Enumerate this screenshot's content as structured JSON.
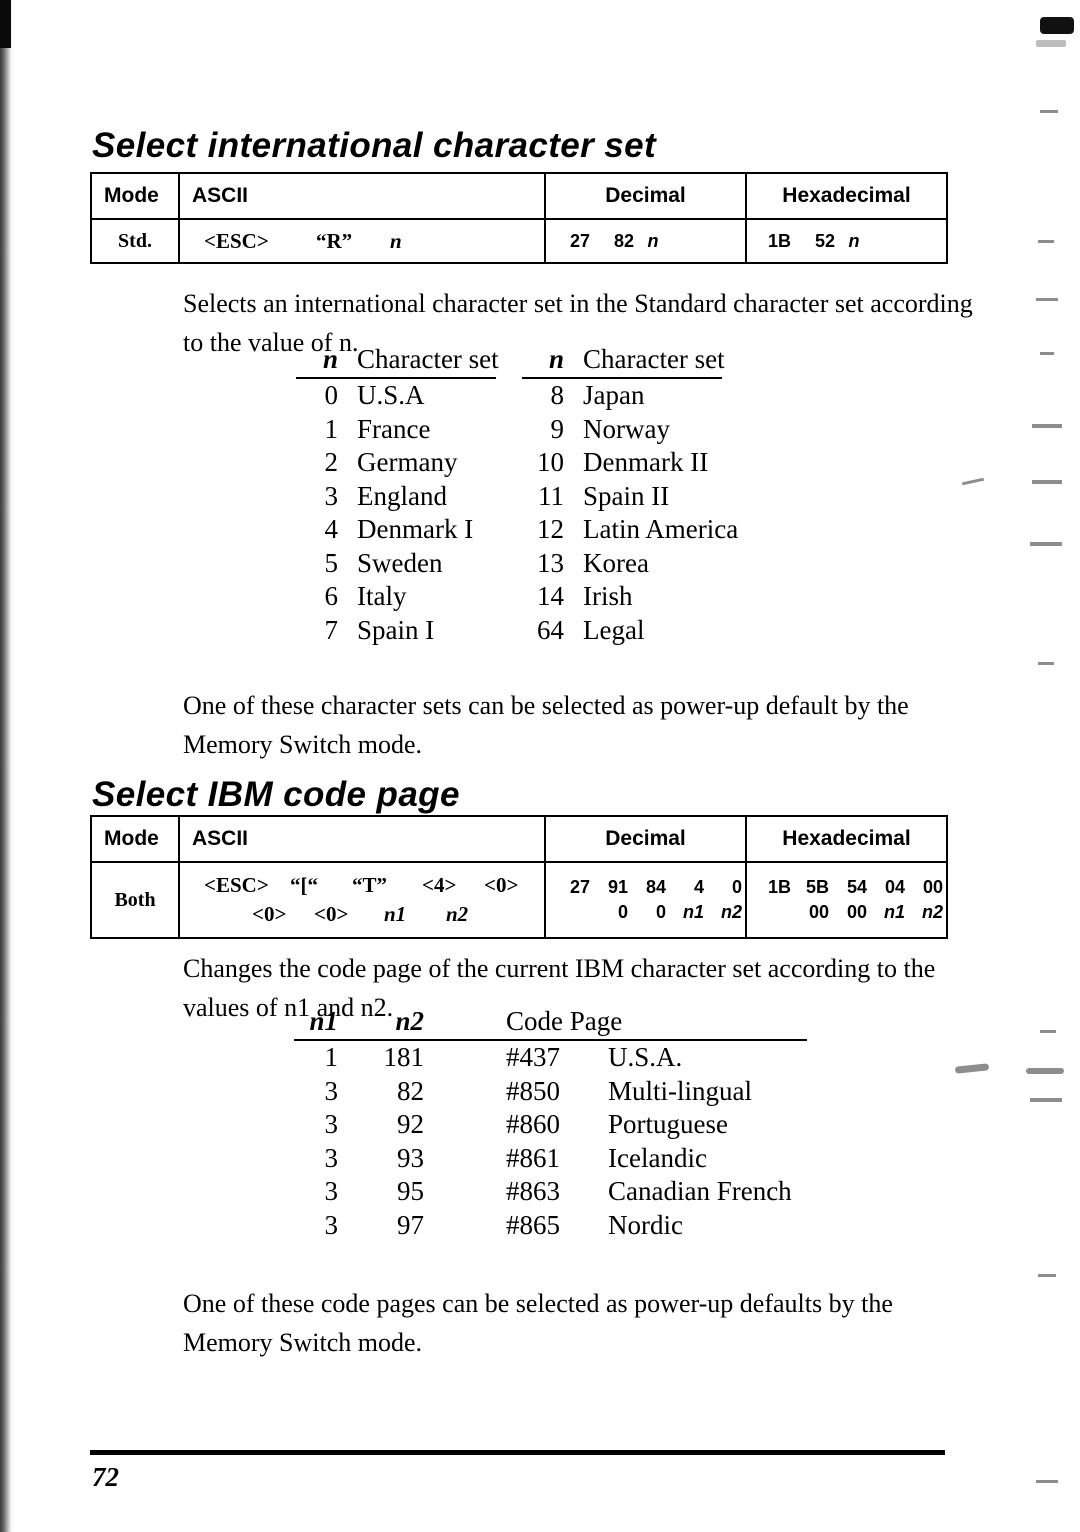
{
  "page": {
    "number": "72"
  },
  "sections": [
    {
      "id": "international",
      "title": "Select international character set",
      "table": {
        "headers": {
          "mode": "Mode",
          "ascii": "ASCII",
          "decimal": "Decimal",
          "hexadecimal": "Hexadecimal"
        },
        "rows": [
          {
            "mode": "Std.",
            "ascii_line1": [
              "<ESC>",
              "“R”",
              "n"
            ],
            "decimal_line1": [
              "27",
              "82",
              "n"
            ],
            "hex_line1": [
              "1B",
              "52",
              "n"
            ]
          }
        ]
      },
      "description": "Selects an international character set in the Standard character set according to the value of n.",
      "list": {
        "head_key": "n",
        "head_value": "Character set",
        "left": [
          {
            "n": "0",
            "name": "U.S.A"
          },
          {
            "n": "1",
            "name": "France"
          },
          {
            "n": "2",
            "name": "Germany"
          },
          {
            "n": "3",
            "name": "England"
          },
          {
            "n": "4",
            "name": "Denmark I"
          },
          {
            "n": "5",
            "name": "Sweden"
          },
          {
            "n": "6",
            "name": "Italy"
          },
          {
            "n": "7",
            "name": "Spain I"
          }
        ],
        "right": [
          {
            "n": "8",
            "name": "Japan"
          },
          {
            "n": "9",
            "name": "Norway"
          },
          {
            "n": "10",
            "name": "Denmark II"
          },
          {
            "n": "11",
            "name": "Spain II"
          },
          {
            "n": "12",
            "name": "Latin America"
          },
          {
            "n": "13",
            "name": "Korea"
          },
          {
            "n": "14",
            "name": "Irish"
          },
          {
            "n": "64",
            "name": "Legal"
          }
        ]
      },
      "footnote": "One of these character sets can be selected as power-up default by the Memory Switch mode."
    },
    {
      "id": "ibm-code-page",
      "title": "Select IBM code page",
      "table": {
        "headers": {
          "mode": "Mode",
          "ascii": "ASCII",
          "decimal": "Decimal",
          "hexadecimal": "Hexadecimal"
        },
        "rows": [
          {
            "mode": "Both",
            "ascii_line1": [
              "<ESC>",
              "“[“",
              "“T”",
              "<4>",
              "<0>"
            ],
            "ascii_line2": [
              "<0>",
              "<0>",
              "n1",
              "n2"
            ],
            "decimal_line1": [
              "27",
              "91",
              "84",
              "4",
              "0"
            ],
            "decimal_line2": [
              "0",
              "0",
              "n1",
              "n2"
            ],
            "hex_line1": [
              "1B",
              "5B",
              "54",
              "04",
              "00"
            ],
            "hex_line2": [
              "00",
              "00",
              "n1",
              "n2"
            ]
          }
        ]
      },
      "description": "Changes the code page of the current IBM character set according to the values of n1 and n2.",
      "list": {
        "head_n1": "n1",
        "head_n2": "n2",
        "head_page": "Code Page",
        "rows": [
          {
            "n1": "1",
            "n2": "181",
            "code": "#437",
            "name": "U.S.A."
          },
          {
            "n1": "3",
            "n2": "82",
            "code": "#850",
            "name": "Multi-lingual"
          },
          {
            "n1": "3",
            "n2": "92",
            "code": "#860",
            "name": "Portuguese"
          },
          {
            "n1": "3",
            "n2": "93",
            "code": "#861",
            "name": "Icelandic"
          },
          {
            "n1": "3",
            "n2": "95",
            "code": "#863",
            "name": "Canadian French"
          },
          {
            "n1": "3",
            "n2": "97",
            "code": "#865",
            "name": "Nordic"
          }
        ]
      },
      "footnote": "One of these code pages can be selected as power-up defaults by the Memory Switch mode."
    }
  ]
}
